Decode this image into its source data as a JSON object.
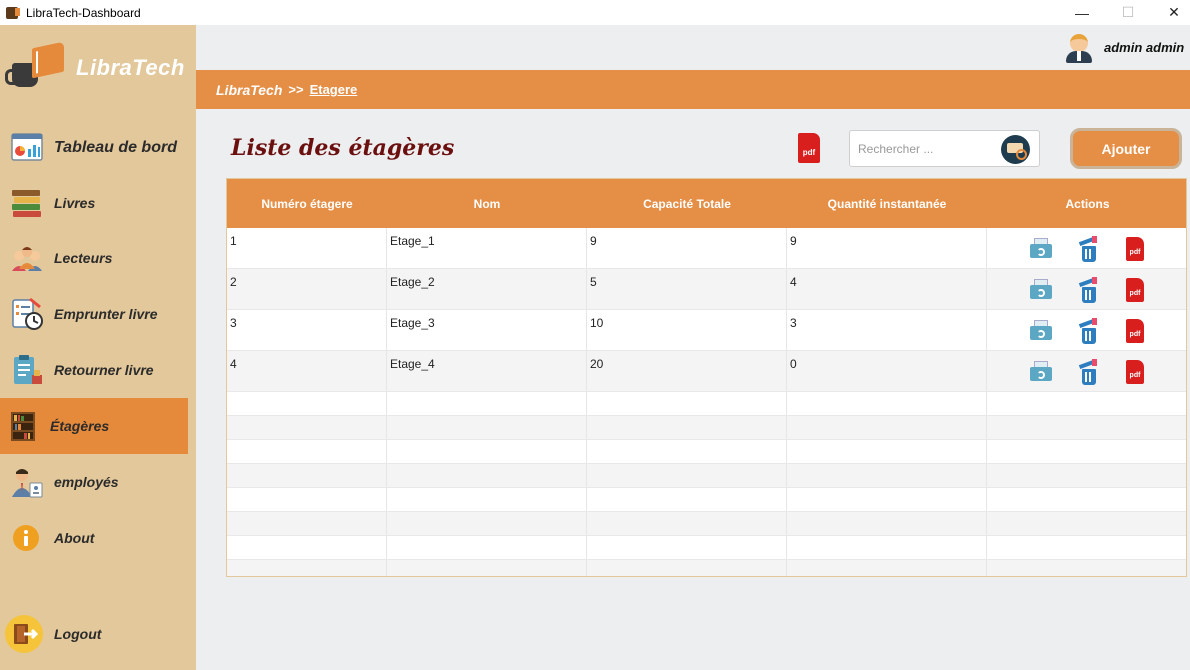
{
  "window": {
    "title": "LibraTech-Dashboard",
    "minimize": "—",
    "maximize": "☐",
    "close": "✕"
  },
  "brand": {
    "name": "LibraTech"
  },
  "user": {
    "name": "admin admin"
  },
  "sidebar": {
    "items": [
      {
        "label": "Tableau de bord",
        "icon": "dashboard-icon"
      },
      {
        "label": "Livres",
        "icon": "books-icon"
      },
      {
        "label": "Lecteurs",
        "icon": "readers-icon"
      },
      {
        "label": "Emprunter livre",
        "icon": "borrow-book-icon"
      },
      {
        "label": "Retourner livre",
        "icon": "return-book-icon"
      },
      {
        "label": "Étagères",
        "icon": "bookshelf-icon",
        "active": true
      },
      {
        "label": "employés",
        "icon": "employee-icon"
      },
      {
        "label": "About",
        "icon": "info-icon"
      }
    ],
    "logout": {
      "label": "Logout",
      "icon": "logout-icon"
    }
  },
  "breadcrumb": {
    "root": "LibraTech",
    "separator": ">>",
    "current": "Etagere"
  },
  "page": {
    "title": "Liste des étagères",
    "export_pdf_label": "pdf",
    "search_placeholder": "Rechercher ...",
    "add_label": "Ajouter"
  },
  "table": {
    "columns": [
      "Numéro étagere",
      "Nom",
      "Capacité Totale",
      "Quantité instantanée",
      "Actions"
    ],
    "rows": [
      {
        "numero": "1",
        "nom": "Etage_1",
        "capacite": "9",
        "quantite": "9"
      },
      {
        "numero": "2",
        "nom": "Etage_2",
        "capacite": "5",
        "quantite": "4"
      },
      {
        "numero": "3",
        "nom": "Etage_3",
        "capacite": "10",
        "quantite": "3"
      },
      {
        "numero": "4",
        "nom": "Etage_4",
        "capacite": "20",
        "quantite": "0"
      }
    ],
    "action_pdf_label": "pdf"
  },
  "colors": {
    "accent": "#e58e45",
    "sidebar": "#e3c89b",
    "background": "#eceeef",
    "title": "#6b0f0f",
    "pdf": "#d91e1e"
  }
}
